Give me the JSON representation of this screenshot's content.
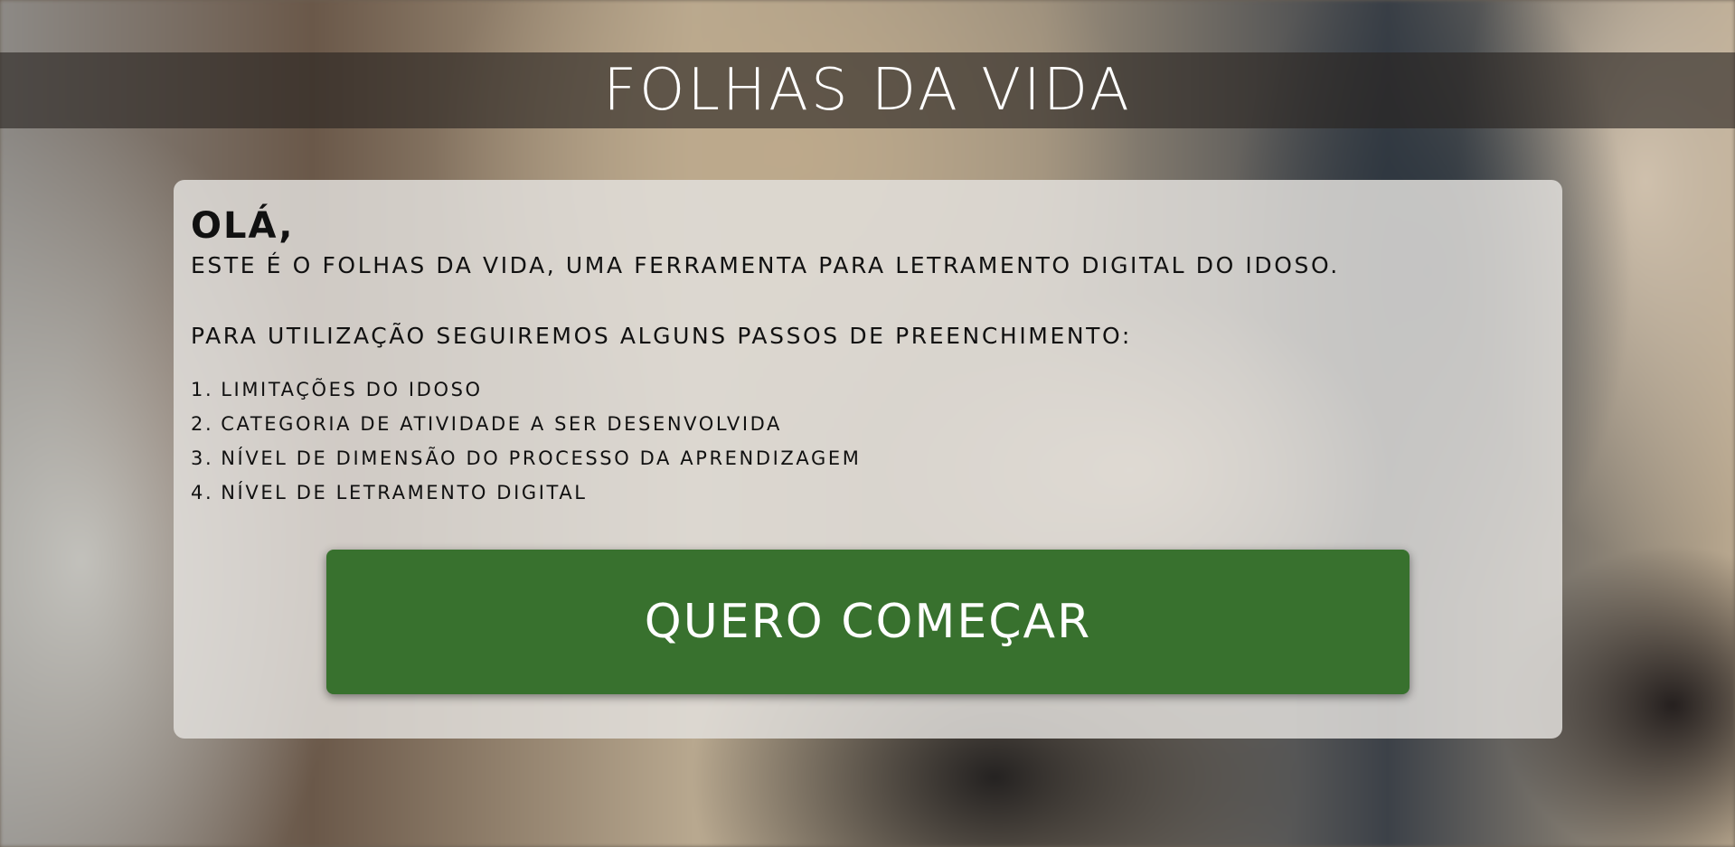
{
  "header": {
    "title": "FOLHAS DA VIDA"
  },
  "card": {
    "greeting": "OLÁ,",
    "intro": "ESTE É O FOLHAS DA VIDA, UMA FERRAMENTA PARA LETRAMENTO DIGITAL DO IDOSO.",
    "steps_title": "PARA UTILIZAÇÃO SEGUIREMOS ALGUNS PASSOS DE PREENCHIMENTO:",
    "steps": [
      {
        "number": "1.",
        "label": "LIMITAÇÕES DO IDOSO"
      },
      {
        "number": "2.",
        "label": "CATEGORIA DE ATIVIDADE A SER DESENVOLVIDA"
      },
      {
        "number": "3.",
        "label": "NÍVEL DE DIMENSÃO DO PROCESSO DA APRENDIZAGEM"
      },
      {
        "number": "4.",
        "label": "NÍVEL DE LETRAMENTO DIGITAL"
      }
    ],
    "start_button_label": "QUERO COMEÇAR"
  },
  "colors": {
    "button_green": "#38712e",
    "title_bar": "#28241f",
    "card_background": "#e2e0dd"
  }
}
